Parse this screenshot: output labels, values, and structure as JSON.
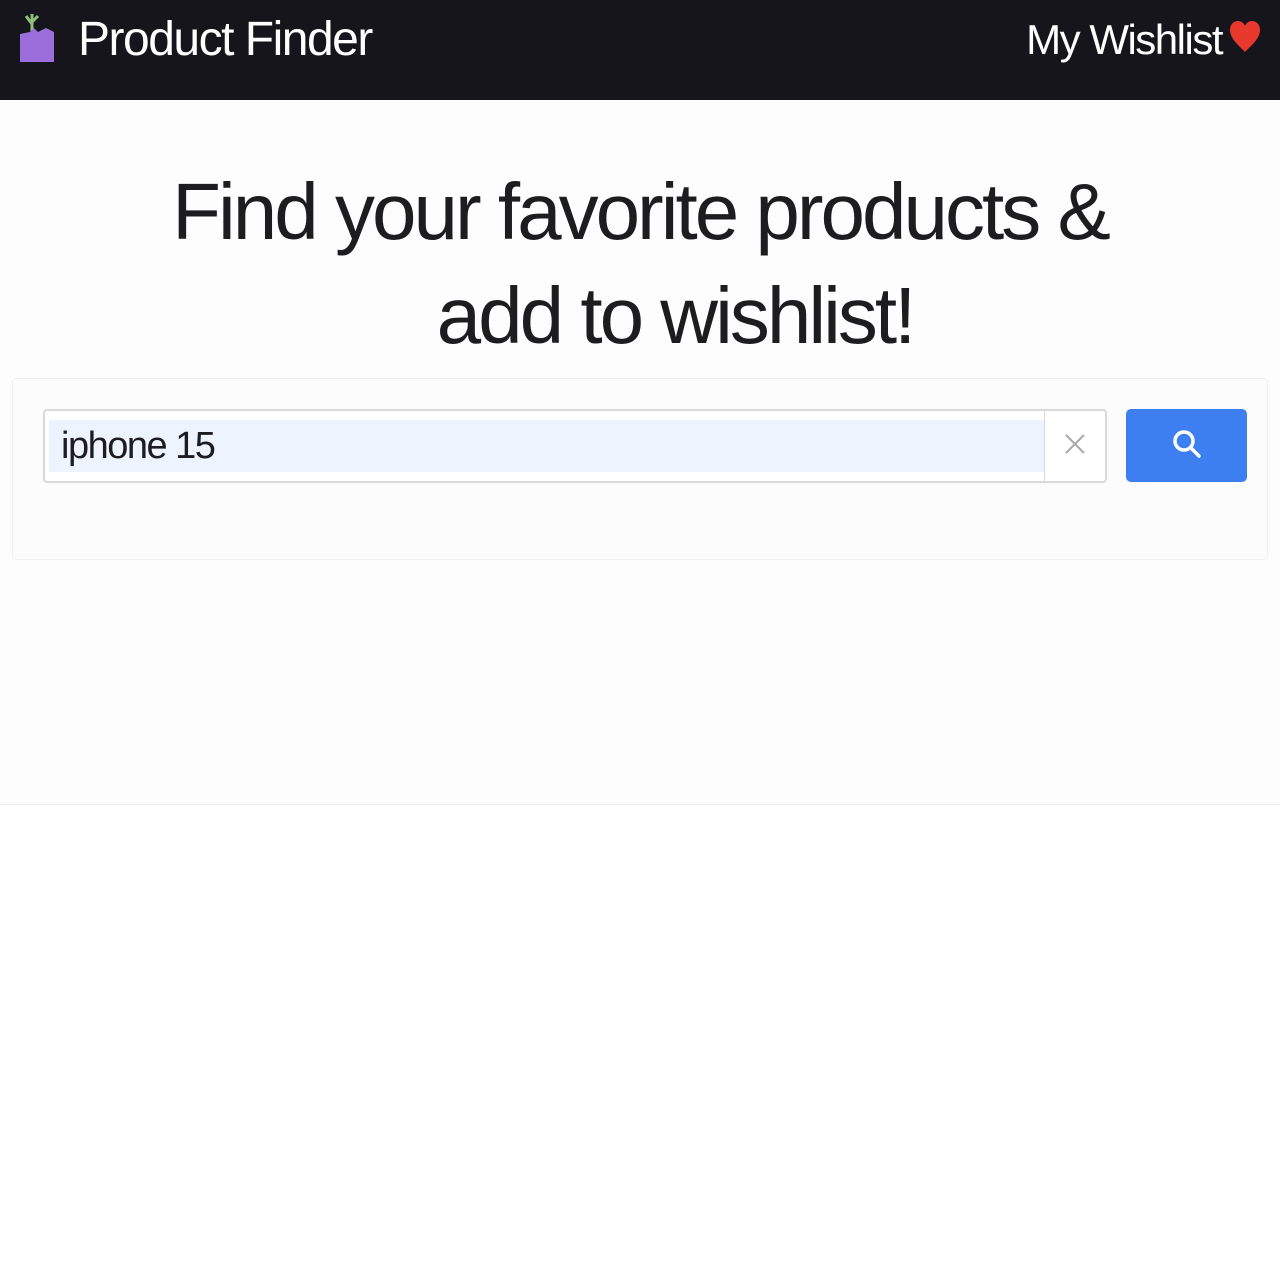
{
  "navbar": {
    "brand_title": "Product Finder",
    "brand_icon": "shopping-bag-icon",
    "wishlist_label": "My Wishlist",
    "wishlist_icon": "heart-icon",
    "background_color": "#15151b",
    "brand_icon_color": "#9a6fdc",
    "heart_color": "#e8392c"
  },
  "hero": {
    "title_line1": "Find your favorite products &",
    "title_line2": "add to wishlist!"
  },
  "search": {
    "value": "iphone 15",
    "clear_icon": "close-icon",
    "button_icon": "search-icon",
    "button_color": "#3d7ef0"
  }
}
